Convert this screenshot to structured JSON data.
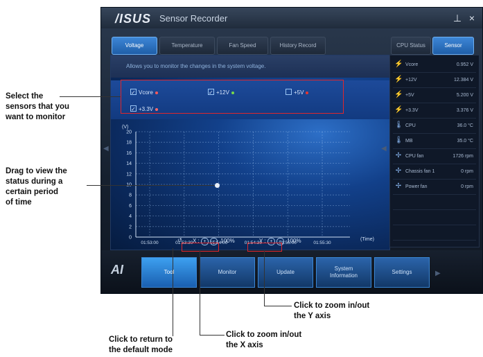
{
  "window": {
    "logo": "/ISUS",
    "title": "Sensor Recorder",
    "pin_glyph": "⊥",
    "close_glyph": "×"
  },
  "tabs": [
    {
      "label": "Voltage",
      "active": true
    },
    {
      "label": "Temperature",
      "active": false
    },
    {
      "label": "Fan Speed",
      "active": false
    },
    {
      "label": "History Record",
      "active": false
    }
  ],
  "info_text": "Allows you to monitor the changes in the system voltage.",
  "sensors": [
    {
      "label": "Vcore",
      "checked": true,
      "color": "#ff5a5a"
    },
    {
      "label": "+12V",
      "checked": true,
      "color": "#7ad94a"
    },
    {
      "label": "+5V",
      "checked": false,
      "color": "#e8372f"
    },
    {
      "label": "+3.3V",
      "checked": true,
      "color": "#ff6a6a"
    }
  ],
  "chart": {
    "y_unit": "(V)",
    "x_unit": "(Time)",
    "y_ticks": [
      "20",
      "18",
      "16",
      "14",
      "12",
      "10",
      "8",
      "6",
      "4",
      "2",
      "0"
    ],
    "x_ticks": [
      "01:53:00",
      "01:53:30",
      "01:54:00",
      "01:54:30",
      "01:55:00",
      "01:55:30"
    ]
  },
  "zoom": {
    "x_label": "X :",
    "x_value": "100%",
    "y_label": "Y :",
    "y_value": "100%",
    "reset_glyph": "↺",
    "zoom_in_glyph": "+",
    "zoom_out_glyph": "−"
  },
  "right_tabs": [
    {
      "label": "CPU Status",
      "active": false
    },
    {
      "label": "Sensor",
      "active": true
    }
  ],
  "sensor_list": [
    {
      "icon": "⚡",
      "icon_name": "voltage-icon",
      "name": "Vcore",
      "value": "0.952 V"
    },
    {
      "icon": "⚡",
      "icon_name": "voltage-icon",
      "name": "+12V",
      "value": "12.384 V"
    },
    {
      "icon": "⚡",
      "icon_name": "voltage-icon",
      "name": "+5V",
      "value": "5.200 V"
    },
    {
      "icon": "⚡",
      "icon_name": "voltage-icon",
      "name": "+3.3V",
      "value": "3.376 V"
    },
    {
      "icon": "🌡",
      "icon_name": "thermometer-icon",
      "name": "CPU",
      "value": "36.0 °C"
    },
    {
      "icon": "🌡",
      "icon_name": "thermometer-icon",
      "name": "MB",
      "value": "35.0 °C"
    },
    {
      "icon": "✢",
      "icon_name": "fan-icon",
      "name": "CPU fan",
      "value": "1726 rpm"
    },
    {
      "icon": "✢",
      "icon_name": "fan-icon",
      "name": "Chassis fan 1",
      "value": "0 rpm"
    },
    {
      "icon": "✢",
      "icon_name": "fan-icon",
      "name": "Power fan",
      "value": "0 rpm"
    }
  ],
  "nav": [
    {
      "label": "Tool",
      "active": true
    },
    {
      "label": "Monitor",
      "active": false
    },
    {
      "label": "Update",
      "active": false
    },
    {
      "label": "System\nInformation",
      "active": false
    },
    {
      "label": "Settings",
      "active": false
    }
  ],
  "brand_mark": "AI",
  "callouts": {
    "select_sensors": "Select the\nsensors that you\nwant to monitor",
    "drag_view": "Drag to view the\nstatus during a\ncertain period\nof time",
    "zoom_y": "Click to zoom in/out\nthe Y axis",
    "zoom_x": "Click to zoom in/out\nthe X axis",
    "default_mode": "Click to return to\nthe default mode"
  },
  "colors": {
    "accent": "#2f7fd6",
    "highlight": "#e0262b"
  }
}
